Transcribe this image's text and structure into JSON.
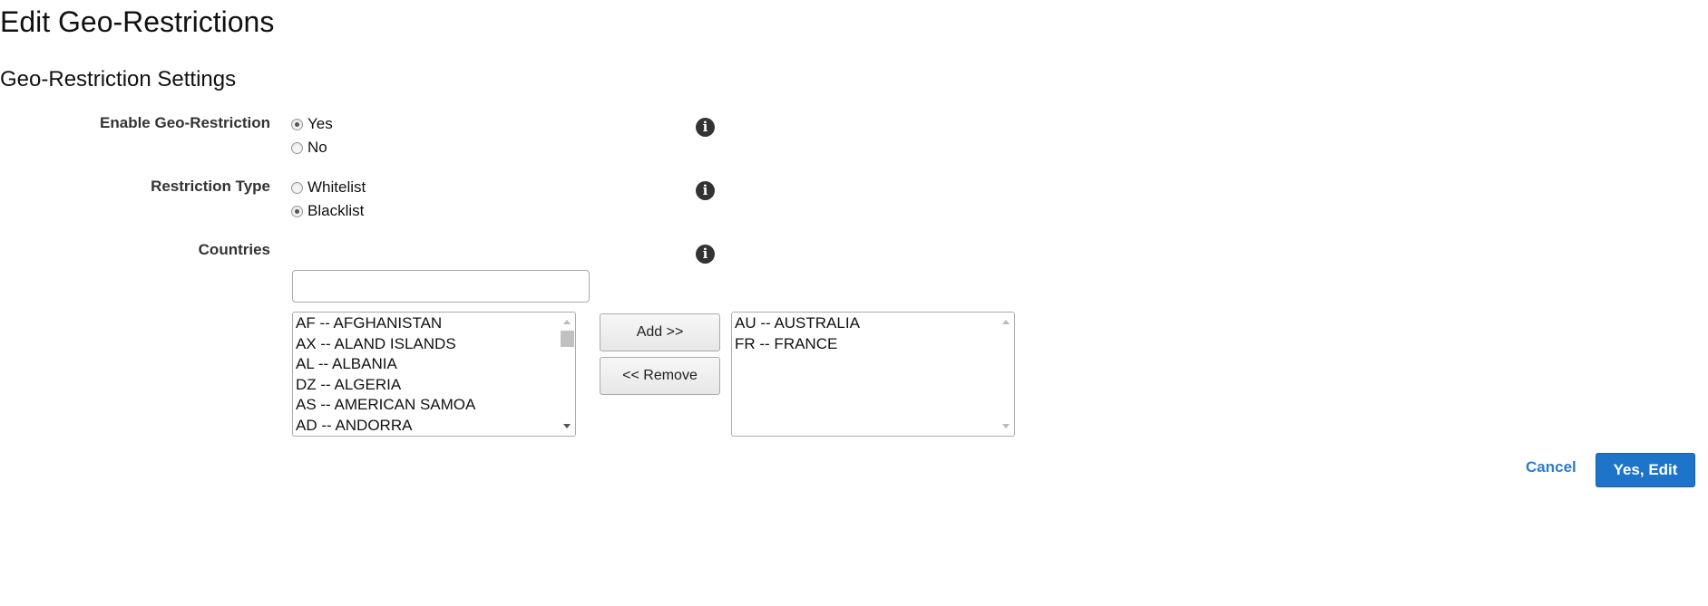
{
  "page": {
    "title": "Edit Geo-Restrictions",
    "section_title": "Geo-Restriction Settings"
  },
  "enable_geo_restriction": {
    "label": "Enable Geo-Restriction",
    "options": [
      {
        "label": "Yes",
        "checked": true
      },
      {
        "label": "No",
        "checked": false
      }
    ],
    "info_icon": "info-icon"
  },
  "restriction_type": {
    "label": "Restriction Type",
    "options": [
      {
        "label": "Whitelist",
        "checked": false
      },
      {
        "label": "Blacklist",
        "checked": true
      }
    ],
    "info_icon": "info-icon"
  },
  "countries": {
    "label": "Countries",
    "filter_value": "",
    "available": [
      "AF -- AFGHANISTAN",
      "AX -- ALAND ISLANDS",
      "AL -- ALBANIA",
      "DZ -- ALGERIA",
      "AS -- AMERICAN SAMOA",
      "AD -- ANDORRA"
    ],
    "selected": [
      "AU -- AUSTRALIA",
      "FR -- FRANCE"
    ],
    "add_label": "Add >>",
    "remove_label": "<< Remove",
    "info_icon": "info-icon"
  },
  "actions": {
    "cancel_label": "Cancel",
    "confirm_label": "Yes, Edit"
  },
  "colors": {
    "primary": "#1d74c9",
    "link": "#2b7bd0"
  }
}
